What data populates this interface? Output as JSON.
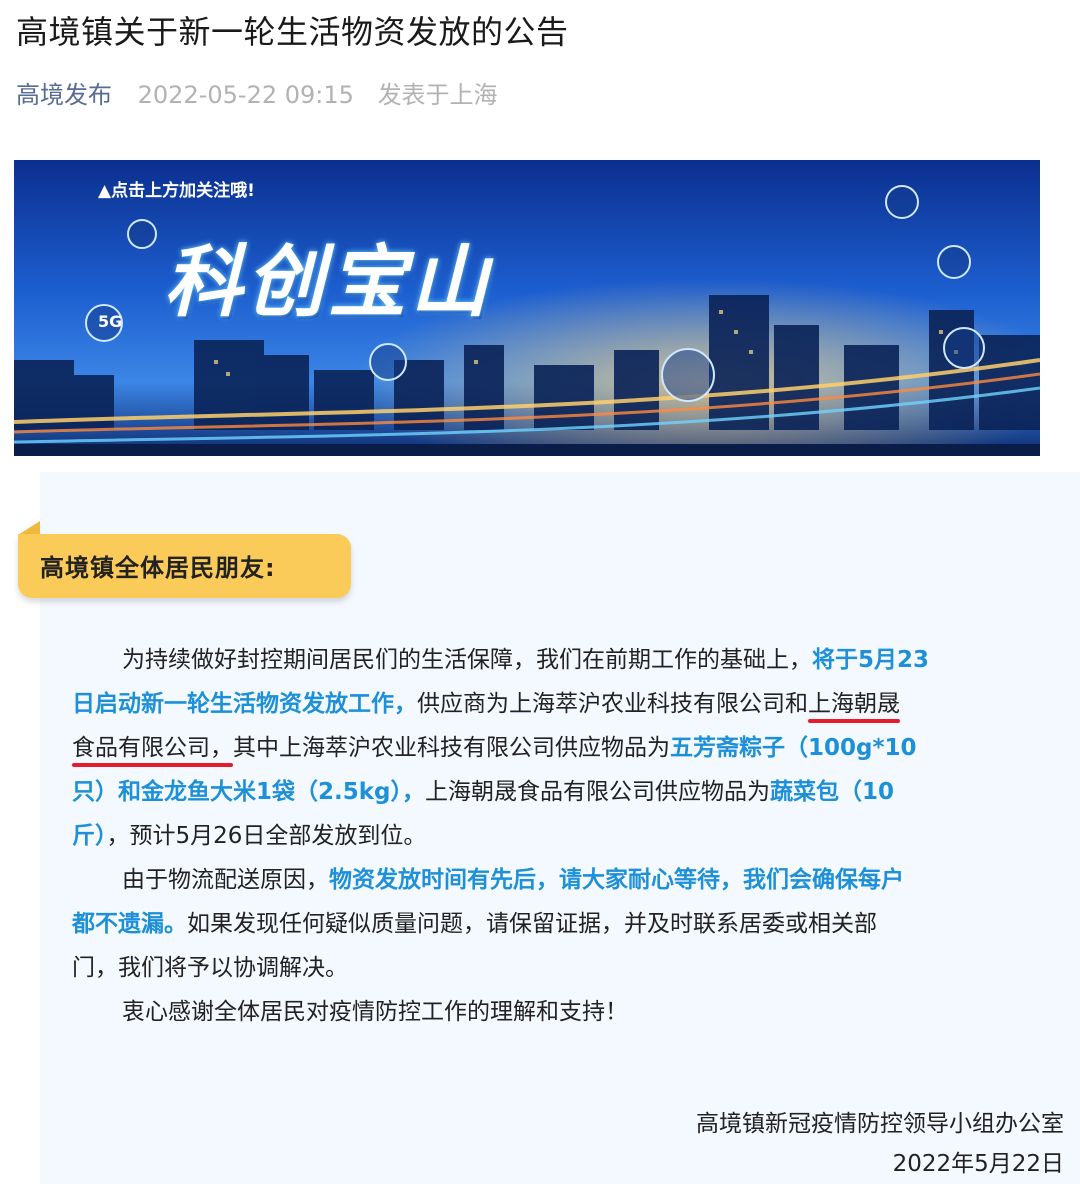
{
  "article": {
    "title": "高境镇关于新一轮生活物资发放的公告",
    "author": "高境发布",
    "date": "2022-05-22 09:15",
    "location": "发表于上海"
  },
  "banner": {
    "follow_text": "▲点击上方加关注哦!",
    "title": "科创宝山",
    "badge": "5G",
    "icons": [
      "laptop-icon",
      "swimmer-icon",
      "globe-icon",
      "tablet-icon",
      "heartbeat-icon",
      "gamepad-icon"
    ]
  },
  "letter": {
    "salutation": "高境镇全体居民朋友:",
    "lines": [
      [
        "为持续做好封控期间居民们的生活保障，我们在前期工作的基础上，",
        "将于5月23"
      ],
      [
        "日启动新一轮生活物资发放工作，",
        "供应商为上海萃沪农业科技有限公司和",
        "上海朝晟"
      ],
      [
        "食品有限公司，",
        "其中上海萃沪农业科技有限公司供应物品为",
        "五芳斋粽子（100g*10"
      ],
      [
        "只）和金龙鱼大米1袋（2.5kg），",
        "上海朝晟食品有限公司供应物品为",
        "蔬菜包（10"
      ],
      [
        "斤）",
        "，预计5月26日全部发放到位。"
      ],
      [
        "由于物流配送原因，",
        "物资发放时间有先后，请大家耐心等待，我们会确保每户"
      ],
      [
        "都不遗漏。",
        "如果发现任何疑似质量问题，请保留证据，并及时联系居委或相关部"
      ],
      [
        "门，我们将予以协调解决。"
      ],
      [
        "衷心感谢全体居民对疫情防控工作的理解和支持！"
      ]
    ],
    "signature_org": "高境镇新冠疫情防控领导小组办公室",
    "signature_date": "2022年5月22日"
  },
  "colors": {
    "link_blue": "#576b95",
    "highlight_blue": "#1e90d8",
    "tag_yellow": "#fbcb59",
    "underline_red": "#e61b2e",
    "letter_bg": "#f4f9ff"
  }
}
